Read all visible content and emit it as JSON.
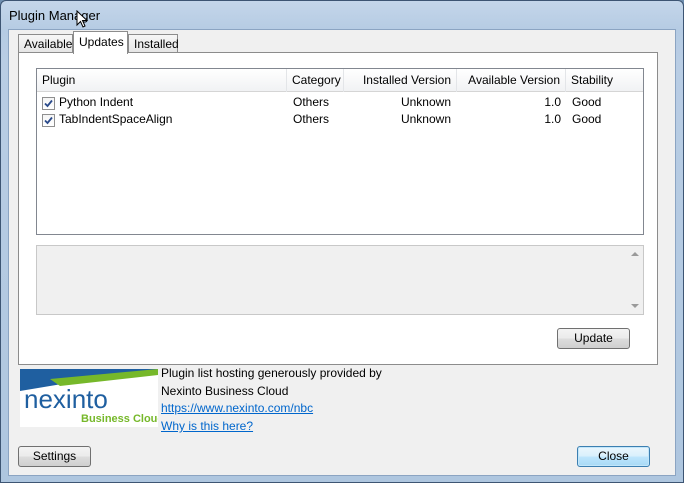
{
  "window": {
    "title": "Plugin Manager"
  },
  "tabs": [
    {
      "label": "Available",
      "active": false
    },
    {
      "label": "Updates",
      "active": true
    },
    {
      "label": "Installed",
      "active": false
    }
  ],
  "table": {
    "columns": [
      "Plugin",
      "Category",
      "Installed Version",
      "Available Version",
      "Stability"
    ],
    "rows": [
      {
        "checked": true,
        "plugin": "Python Indent",
        "category": "Others",
        "installed_version": "Unknown",
        "available_version": "1.0",
        "stability": "Good"
      },
      {
        "checked": true,
        "plugin": "TabIndentSpaceAlign",
        "category": "Others",
        "installed_version": "Unknown",
        "available_version": "1.0",
        "stability": "Good"
      }
    ]
  },
  "buttons": {
    "update": "Update",
    "settings": "Settings",
    "close": "Close"
  },
  "hosting": {
    "line1": "Plugin list hosting generously provided by",
    "line2": "Nexinto Business Cloud",
    "url": "https://www.nexinto.com/nbc",
    "why": "Why is this here?"
  },
  "logo": {
    "brand": "nexinto",
    "tagline": "Business Cloud"
  },
  "colors": {
    "link": "#0066cc",
    "logo_blue": "#1f5fa0",
    "logo_green": "#76b82a"
  }
}
